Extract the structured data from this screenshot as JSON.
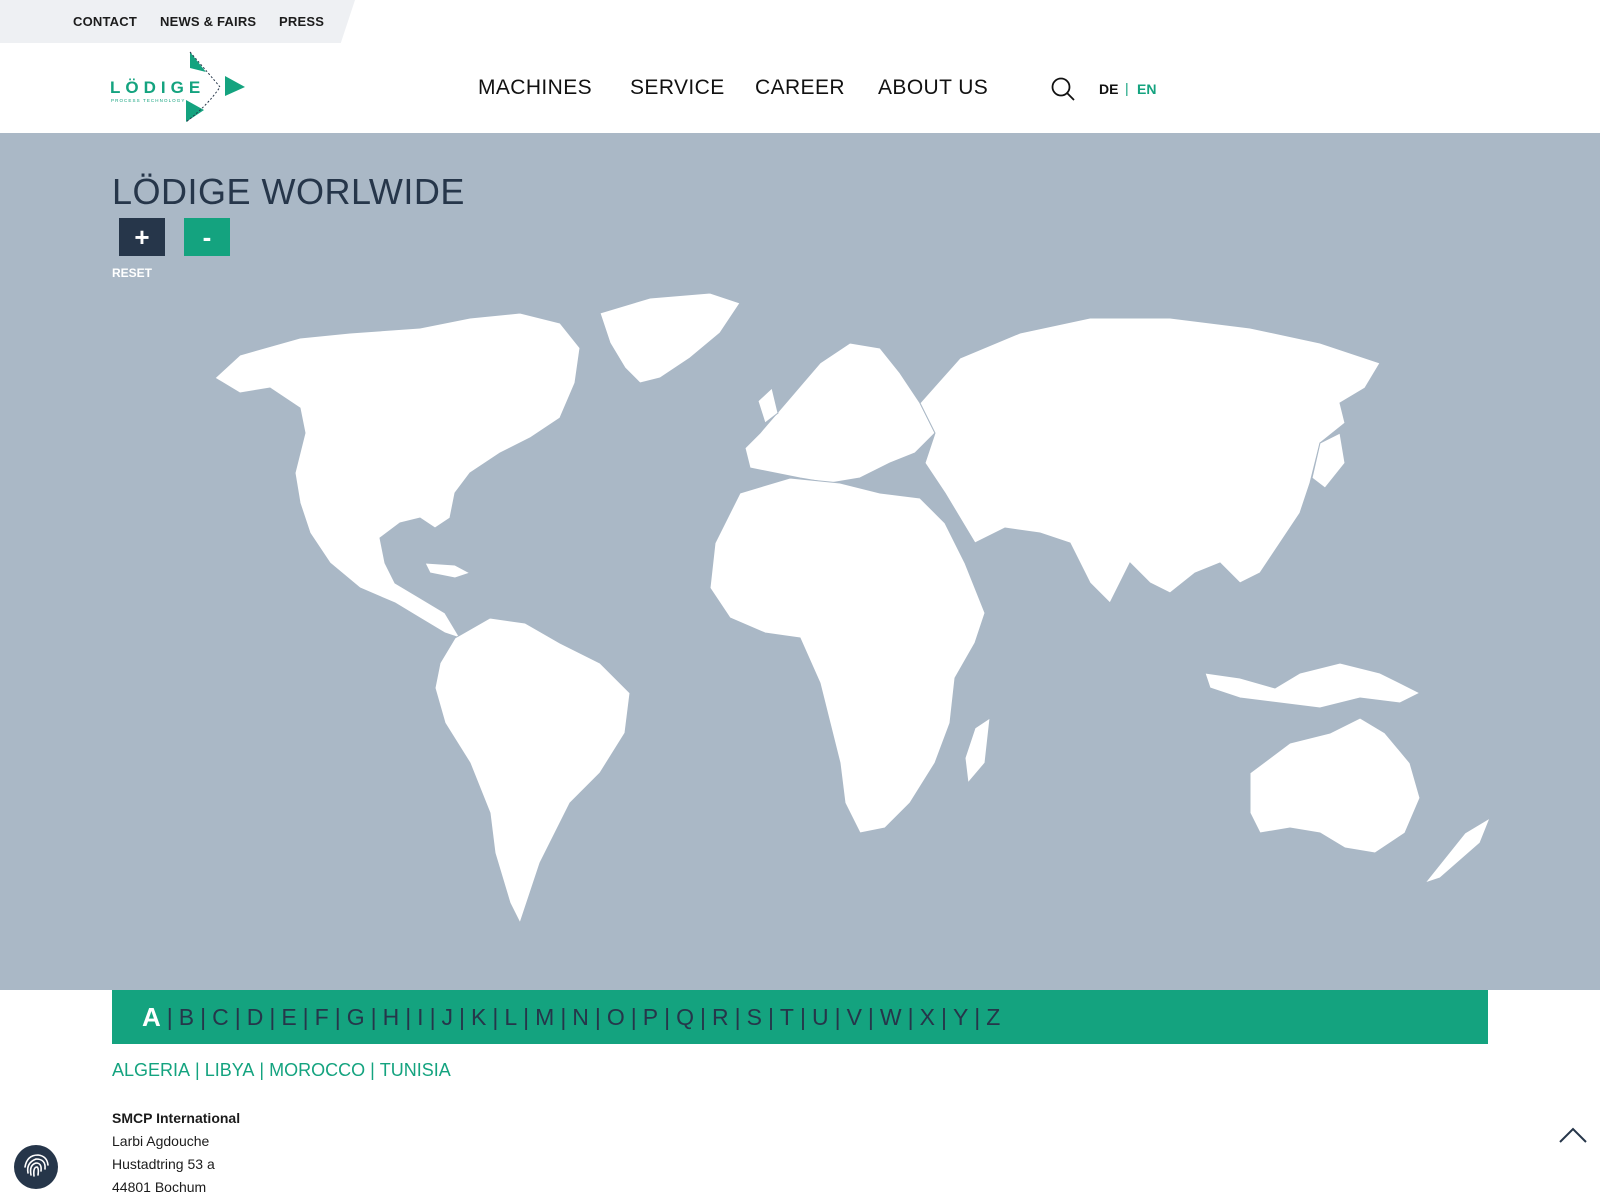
{
  "topbar": {
    "links": [
      "CONTACT",
      "NEWS & FAIRS",
      "PRESS"
    ]
  },
  "logo": {
    "text": "LÖDIGE",
    "subtext": "PROCESS TECHNOLOGY"
  },
  "nav": {
    "items": [
      "MACHINES",
      "SERVICE",
      "CAREER",
      "ABOUT US"
    ]
  },
  "lang": {
    "de": "DE",
    "separator": "|",
    "en": "EN",
    "active": "EN"
  },
  "map": {
    "title": "LÖDIGE WORLWIDE",
    "zoom_in": "+",
    "zoom_out": "-",
    "reset": "RESET"
  },
  "alphabet": {
    "letters": [
      "A",
      "B",
      "C",
      "D",
      "E",
      "F",
      "G",
      "H",
      "I",
      "J",
      "K",
      "L",
      "M",
      "N",
      "O",
      "P",
      "Q",
      "R",
      "S",
      "T",
      "U",
      "V",
      "W",
      "X",
      "Y",
      "Z"
    ],
    "active": "A"
  },
  "countries": [
    "ALGERIA",
    "LIBYA",
    "MOROCCO",
    "TUNISIA"
  ],
  "address": {
    "company": "SMCP International",
    "contact": "Larbi Agdouche",
    "street": "Hustadtring 53 a",
    "city": "44801 Bochum"
  },
  "colors": {
    "accent": "#14a37f",
    "navy": "#26364a",
    "map_bg": "#aab8c6"
  },
  "icons": {
    "search": "search-icon",
    "privacy": "fingerprint-icon",
    "scroll_top": "chevron-up-icon"
  }
}
